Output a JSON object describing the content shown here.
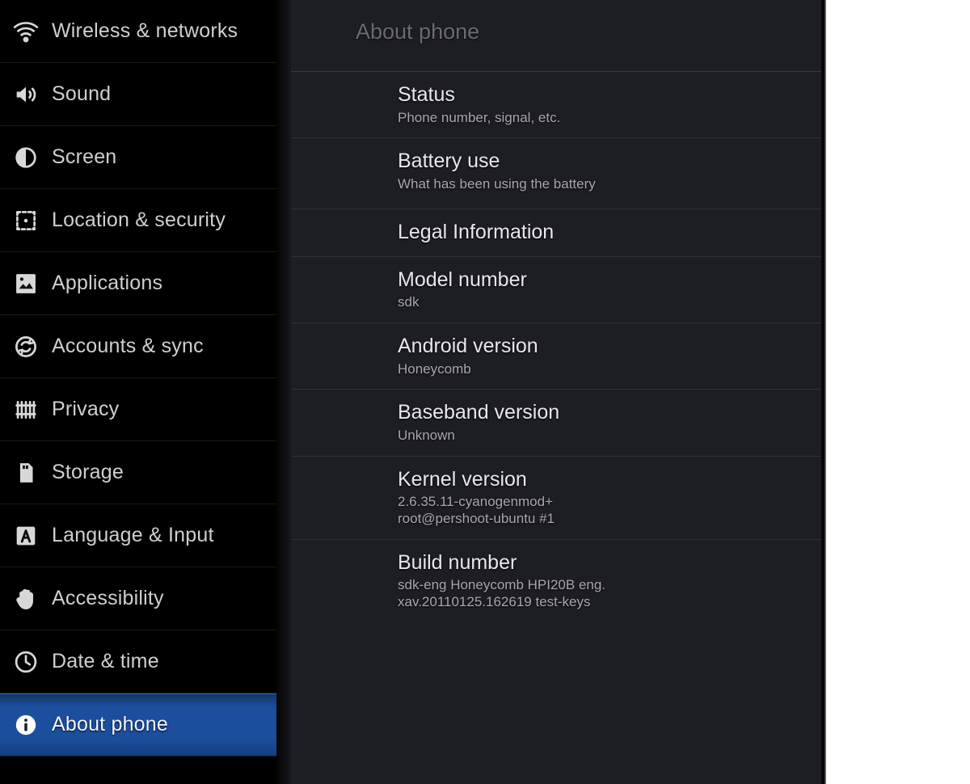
{
  "sidebar": {
    "items": [
      {
        "label": "Wireless & networks",
        "icon": "wifi-icon",
        "selected": false
      },
      {
        "label": "Sound",
        "icon": "sound-icon",
        "selected": false
      },
      {
        "label": "Screen",
        "icon": "brightness-icon",
        "selected": false
      },
      {
        "label": "Location & security",
        "icon": "location-security-icon",
        "selected": false
      },
      {
        "label": "Applications",
        "icon": "applications-icon",
        "selected": false
      },
      {
        "label": "Accounts & sync",
        "icon": "accounts-sync-icon",
        "selected": false
      },
      {
        "label": "Privacy",
        "icon": "privacy-icon",
        "selected": false
      },
      {
        "label": "Storage",
        "icon": "storage-icon",
        "selected": false
      },
      {
        "label": "Language & Input",
        "icon": "language-input-icon",
        "selected": false
      },
      {
        "label": "Accessibility",
        "icon": "accessibility-hand-icon",
        "selected": false
      },
      {
        "label": "Date & time",
        "icon": "clock-icon",
        "selected": false
      },
      {
        "label": "About phone",
        "icon": "info-icon",
        "selected": true
      }
    ]
  },
  "content": {
    "title": "About phone",
    "rows": [
      {
        "title": "Status",
        "sub": [
          "Phone number, signal, etc."
        ]
      },
      {
        "title": "Battery use",
        "sub": [
          "What has been using the battery"
        ]
      },
      {
        "title": "Legal Information",
        "sub": []
      },
      {
        "title": "Model number",
        "sub": [
          "sdk"
        ]
      },
      {
        "title": "Android version",
        "sub": [
          "Honeycomb"
        ]
      },
      {
        "title": "Baseband version",
        "sub": [
          "Unknown"
        ]
      },
      {
        "title": "Kernel version",
        "sub": [
          "2.6.35.11-cyanogenmod+",
          "root@pershoot-ubuntu #1"
        ]
      },
      {
        "title": "Build number",
        "sub": [
          "sdk-eng Honeycomb HPI20B eng.",
          "xav.20110125.162619 test-keys"
        ]
      }
    ]
  },
  "colors": {
    "sidebar_background": "#000000",
    "content_background": "#1d1d24",
    "selection_blue": "#1b4f9e",
    "title_dim": "#6a6a72",
    "row_title": "#e8e8ec",
    "row_sub": "#a7a7ad",
    "divider": "#313139",
    "page_background": "#ffffff"
  }
}
